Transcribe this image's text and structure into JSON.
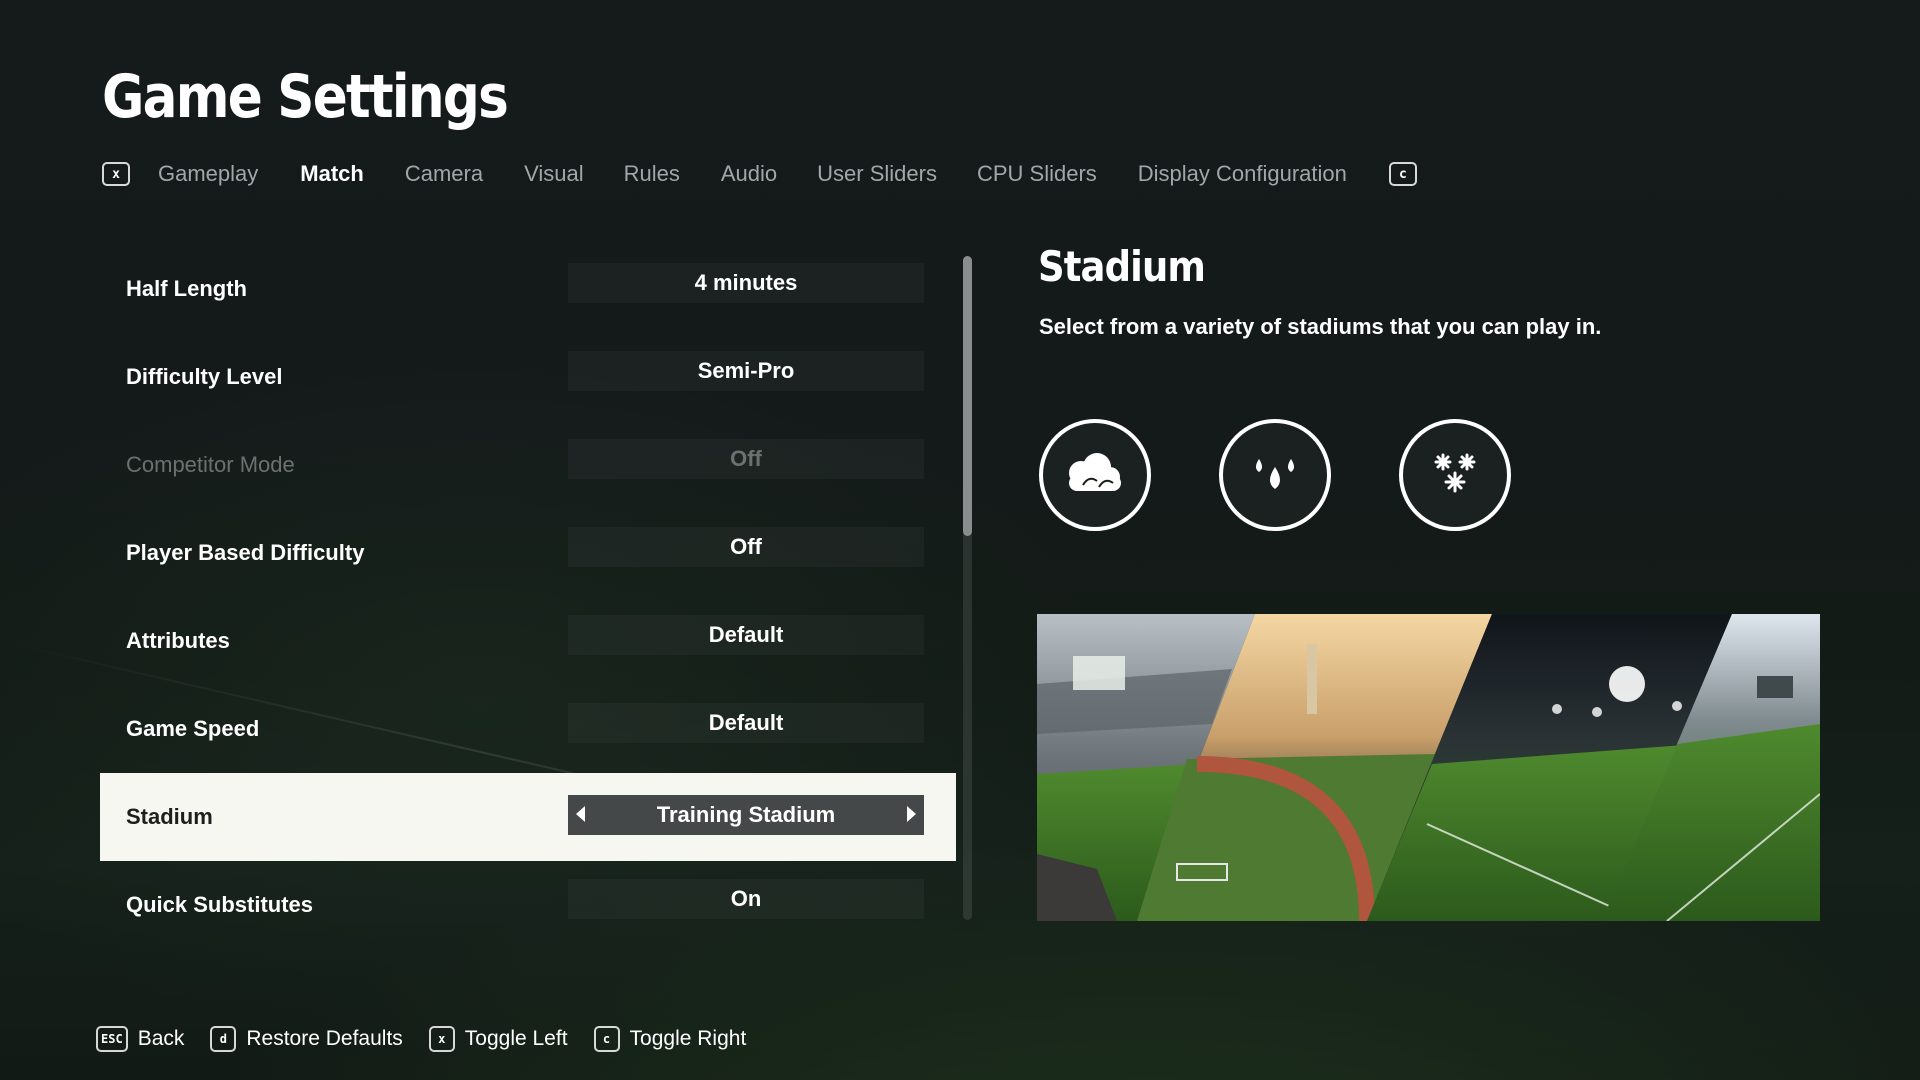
{
  "page": {
    "title": "Game Settings"
  },
  "tabs": {
    "prev_key": "x",
    "next_key": "c",
    "items": [
      {
        "label": "Gameplay",
        "active": false
      },
      {
        "label": "Match",
        "active": true
      },
      {
        "label": "Camera",
        "active": false
      },
      {
        "label": "Visual",
        "active": false
      },
      {
        "label": "Rules",
        "active": false
      },
      {
        "label": "Audio",
        "active": false
      },
      {
        "label": "User Sliders",
        "active": false
      },
      {
        "label": "CPU Sliders",
        "active": false
      },
      {
        "label": "Display Configuration",
        "active": false
      }
    ]
  },
  "settings": [
    {
      "label": "Half Length",
      "value": "4 minutes",
      "state": "normal"
    },
    {
      "label": "Difficulty Level",
      "value": "Semi-Pro",
      "state": "normal"
    },
    {
      "label": "Competitor Mode",
      "value": "Off",
      "state": "disabled"
    },
    {
      "label": "Player Based Difficulty",
      "value": "Off",
      "state": "normal"
    },
    {
      "label": "Attributes",
      "value": "Default",
      "state": "normal"
    },
    {
      "label": "Game Speed",
      "value": "Default",
      "state": "normal"
    },
    {
      "label": "Stadium",
      "value": "Training Stadium",
      "state": "selected"
    },
    {
      "label": "Quick Substitutes",
      "value": "On",
      "state": "normal"
    }
  ],
  "detail": {
    "title": "Stadium",
    "description": "Select from a variety of stadiums that you can play in.",
    "weather_icons": [
      "cloudy-weather-icon",
      "rain-weather-icon",
      "snow-weather-icon"
    ]
  },
  "footer": [
    {
      "key": "ESC",
      "label": "Back"
    },
    {
      "key": "d",
      "label": "Restore Defaults"
    },
    {
      "key": "x",
      "label": "Toggle Left"
    },
    {
      "key": "c",
      "label": "Toggle Right"
    }
  ],
  "colors": {
    "selected_row_bg": "#f7f7f2",
    "selected_value_bg": "#454848",
    "disabled_text": "#6c7170",
    "inactive_tab_text": "#a3a6a8"
  }
}
